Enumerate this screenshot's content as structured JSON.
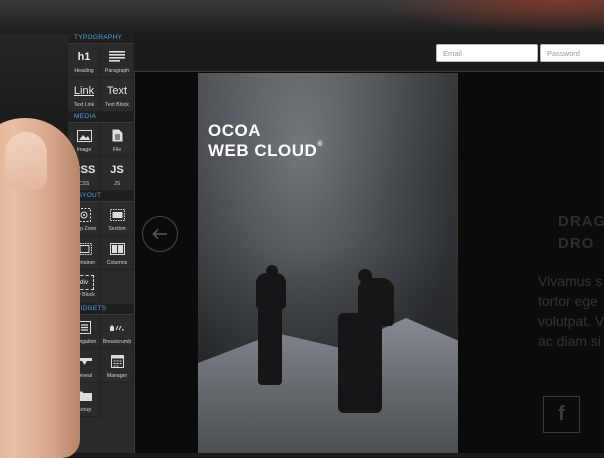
{
  "sidebar": {
    "sections": [
      {
        "title": "TYPOGRAPHY",
        "tiles": [
          {
            "label": "Heading",
            "glyph": "h1",
            "icon": "heading-icon"
          },
          {
            "label": "Paragraph",
            "glyph": "",
            "icon": "paragraph-icon"
          },
          {
            "label": "Text Link",
            "glyph": "Link",
            "icon": "text-link-icon"
          },
          {
            "label": "Text Block",
            "glyph": "Text",
            "icon": "text-block-icon"
          }
        ]
      },
      {
        "title": "MEDIA",
        "tiles": [
          {
            "label": "Image",
            "glyph": "",
            "icon": "image-icon"
          },
          {
            "label": "File",
            "glyph": "",
            "icon": "file-icon"
          },
          {
            "label": "CSS",
            "glyph": "CSS",
            "icon": "css-icon"
          },
          {
            "label": "JS",
            "glyph": "JS",
            "icon": "js-icon"
          }
        ]
      },
      {
        "title": "LAYOUT",
        "tiles": [
          {
            "label": "Drop Zone",
            "glyph": "",
            "icon": "drop-zone-icon"
          },
          {
            "label": "Section",
            "glyph": "",
            "icon": "section-icon"
          },
          {
            "label": "Container",
            "glyph": "",
            "icon": "container-icon"
          },
          {
            "label": "Columns",
            "glyph": "",
            "icon": "columns-icon"
          },
          {
            "label": "Div Block",
            "glyph": "div",
            "icon": "div-block-icon"
          }
        ]
      },
      {
        "title": "WIDGETS",
        "tiles": [
          {
            "label": "Navigation",
            "glyph": "",
            "icon": "navigation-icon"
          },
          {
            "label": "Breadcrumb",
            "glyph": "",
            "icon": "breadcrumb-icon"
          },
          {
            "label": "Reveal",
            "glyph": "",
            "icon": "reveal-icon"
          },
          {
            "label": "Manager",
            "glyph": "",
            "icon": "manager-icon"
          },
          {
            "label": "Group",
            "glyph": "",
            "icon": "folder-icon"
          }
        ]
      }
    ]
  },
  "topbar": {
    "email_placeholder": "Email",
    "password_placeholder": "Password"
  },
  "hero": {
    "brand_line_1": "OCOA",
    "brand_line_2": "WEB CLOUD",
    "registered": "®"
  },
  "right_panel": {
    "headline_1": "DRAG",
    "headline_2": "DRO",
    "body_lines": [
      "Vivamus s",
      "tortor ege",
      "volutpat. V",
      "ac diam si"
    ],
    "fb_glyph": "f"
  },
  "colors": {
    "accent": "#4aa3e0",
    "sidebar_bg": "#2b2b2b",
    "screen_bg": "#0b0b0b"
  }
}
